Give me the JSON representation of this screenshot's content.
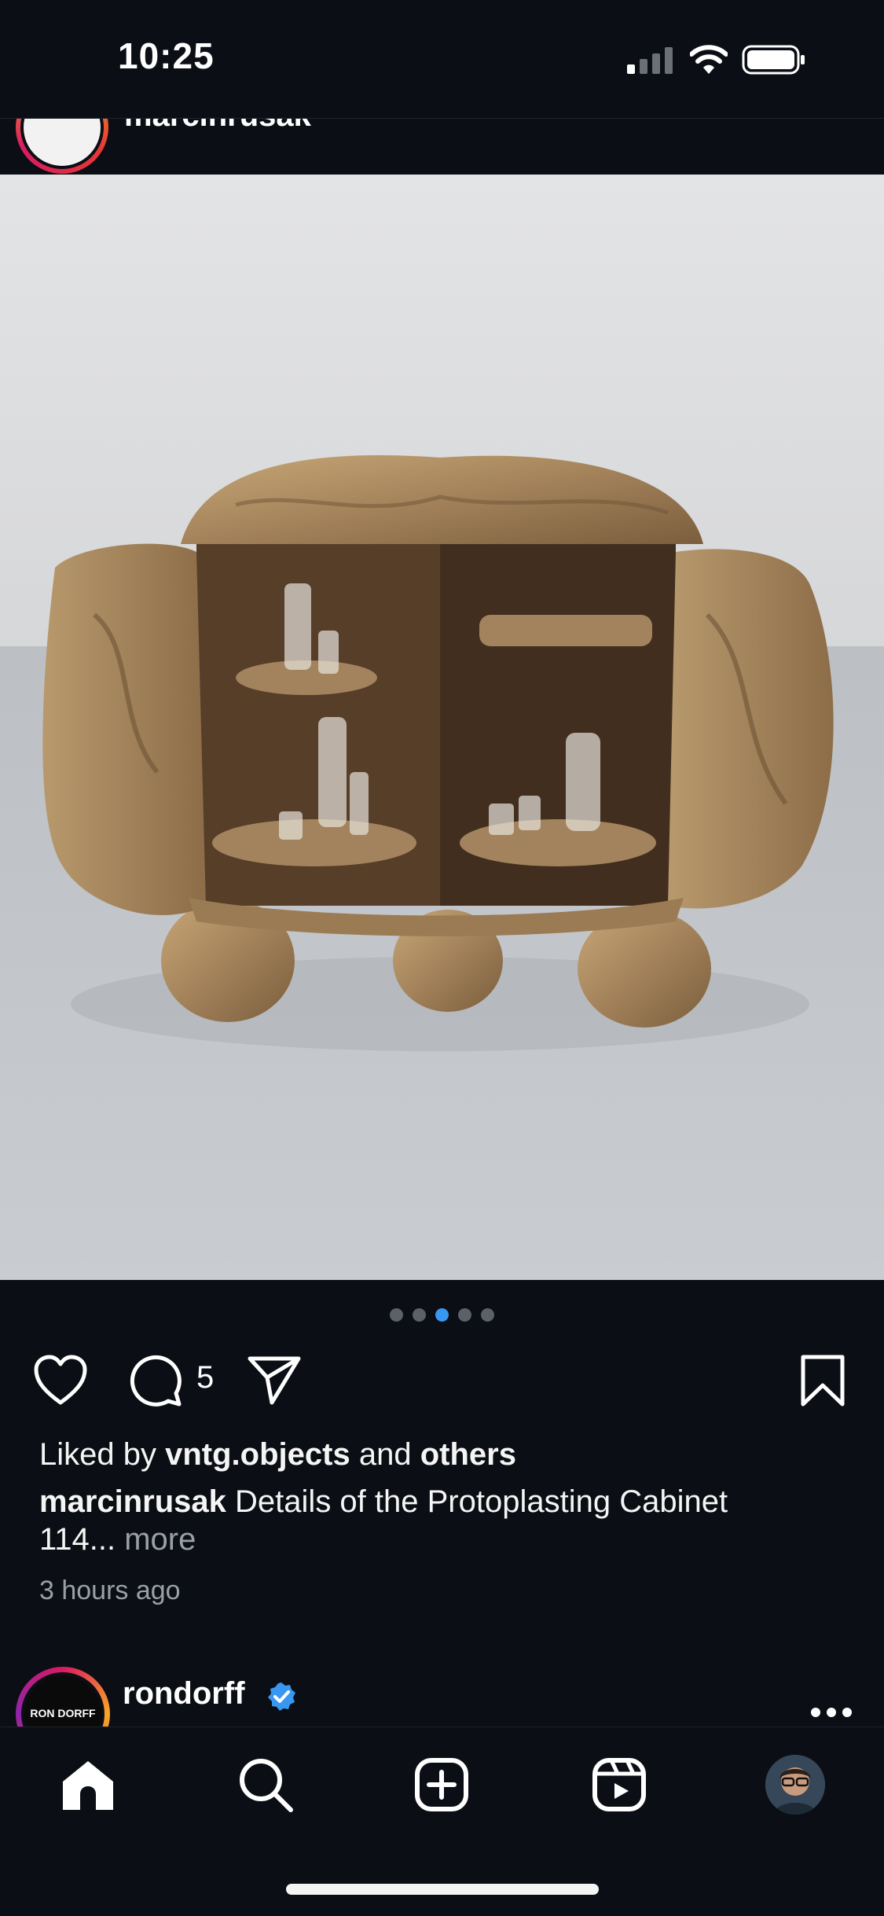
{
  "status_bar": {
    "time": "10:25"
  },
  "previous_post": {
    "username": "marcinrusak"
  },
  "post": {
    "carousel": {
      "count": 5,
      "active_index": 2
    },
    "comment_count": "5",
    "likes": {
      "prefix": "Liked by",
      "user": "vntg.objects",
      "conjunction": "and",
      "others": "others"
    },
    "caption": {
      "username": "marcinrusak",
      "text_line1": "Details of the Protoplasting Cabinet",
      "text_line2": "114...",
      "more": "more"
    },
    "time_ago": "3 hours ago"
  },
  "next_post": {
    "username": "rondorff",
    "avatar_text": "RON DORFF",
    "verified": true
  },
  "tab_bar": {
    "items": [
      {
        "icon": "home-icon"
      },
      {
        "icon": "search-icon"
      },
      {
        "icon": "create-icon"
      },
      {
        "icon": "reels-icon"
      },
      {
        "icon": "profile-avatar"
      }
    ]
  },
  "colors": {
    "background": "#0b0e14",
    "accent": "#3897f0",
    "muted": "#9aa0a8"
  }
}
